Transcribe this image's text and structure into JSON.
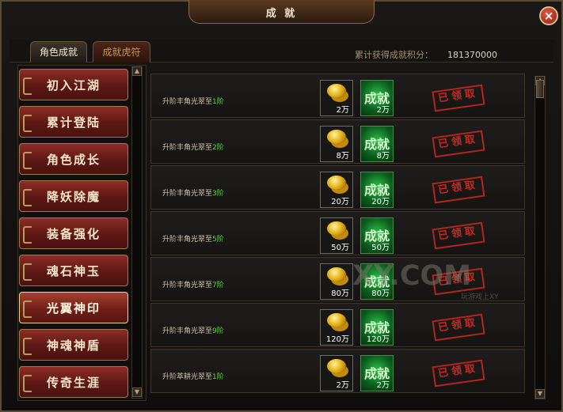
{
  "header": {
    "title": "成 就",
    "close_label": "×"
  },
  "tabs": [
    {
      "label": "角色成就"
    },
    {
      "label": "成就虎符"
    }
  ],
  "points": {
    "label": "累计获得成就积分：",
    "value": "181370000"
  },
  "categories": [
    {
      "label": "初入江湖"
    },
    {
      "label": "累计登陆"
    },
    {
      "label": "角色成长"
    },
    {
      "label": "降妖除魔"
    },
    {
      "label": "装备强化"
    },
    {
      "label": "魂石神玉"
    },
    {
      "label": "光翼神印"
    },
    {
      "label": "神魂神盾"
    },
    {
      "label": "传奇生涯"
    }
  ],
  "scroll": {
    "up": "▲",
    "down": "▼"
  },
  "achievements": [
    {
      "title_prefix": "升阶丰角光翠至",
      "title_level": "1阶",
      "coin_reward": "2万",
      "achievement_label": "成就",
      "achievement_reward": "2万",
      "status": "已领取"
    },
    {
      "title_prefix": "升阶丰角光翠至",
      "title_level": "2阶",
      "coin_reward": "8万",
      "achievement_label": "成就",
      "achievement_reward": "8万",
      "status": "已领取"
    },
    {
      "title_prefix": "升阶丰角光翠至",
      "title_level": "3阶",
      "coin_reward": "20万",
      "achievement_label": "成就",
      "achievement_reward": "20万",
      "status": "已领取"
    },
    {
      "title_prefix": "升阶丰角光翠至",
      "title_level": "5阶",
      "coin_reward": "50万",
      "achievement_label": "成就",
      "achievement_reward": "50万",
      "status": "已领取"
    },
    {
      "title_prefix": "升阶丰角光翠至",
      "title_level": "7阶",
      "coin_reward": "80万",
      "achievement_label": "成就",
      "achievement_reward": "80万",
      "status": "已领取"
    },
    {
      "title_prefix": "升阶丰角光翠至",
      "title_level": "9阶",
      "coin_reward": "120万",
      "achievement_label": "成就",
      "achievement_reward": "120万",
      "status": "已领取"
    },
    {
      "title_prefix": "升阶萃耕光翠至",
      "title_level": "1阶",
      "coin_reward": "2万",
      "achievement_label": "成就",
      "achievement_reward": "2万",
      "status": "已领取"
    }
  ],
  "watermark": {
    "text": "XY.COM",
    "subtext": "玩游戏上XY"
  },
  "colors": {
    "accent": "#65cf45",
    "stamp_red": "#c92a20",
    "panel_gold": "#9b7b4f"
  }
}
